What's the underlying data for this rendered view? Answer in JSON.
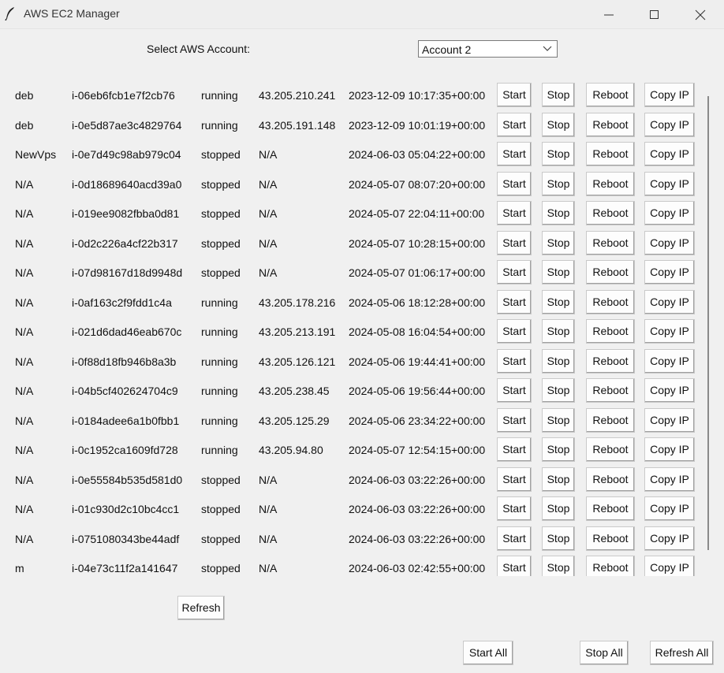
{
  "window": {
    "title": "AWS EC2 Manager",
    "app_icon": "feather-icon",
    "controls": [
      "minimize-icon",
      "maximize-icon",
      "close-icon"
    ]
  },
  "account": {
    "label": "Select AWS Account:",
    "selected": "Account 2"
  },
  "instances": [
    {
      "name": "deb",
      "id": "i-06eb6fcb1e7f2cb76",
      "state": "running",
      "ip": "43.205.210.241",
      "launched": "2023-12-09 10:17:35+00:00"
    },
    {
      "name": "deb",
      "id": "i-0e5d87ae3c4829764",
      "state": "running",
      "ip": "43.205.191.148",
      "launched": "2023-12-09 10:01:19+00:00"
    },
    {
      "name": "NewVps",
      "id": "i-0e7d49c98ab979c04",
      "state": "stopped",
      "ip": "N/A",
      "launched": "2024-06-03 05:04:22+00:00"
    },
    {
      "name": "N/A",
      "id": "i-0d18689640acd39a0",
      "state": "stopped",
      "ip": "N/A",
      "launched": "2024-05-07 08:07:20+00:00"
    },
    {
      "name": "N/A",
      "id": "i-019ee9082fbba0d81",
      "state": "stopped",
      "ip": "N/A",
      "launched": "2024-05-07 22:04:11+00:00"
    },
    {
      "name": "N/A",
      "id": "i-0d2c226a4cf22b317",
      "state": "stopped",
      "ip": "N/A",
      "launched": "2024-05-07 10:28:15+00:00"
    },
    {
      "name": "N/A",
      "id": "i-07d98167d18d9948d",
      "state": "stopped",
      "ip": "N/A",
      "launched": "2024-05-07 01:06:17+00:00"
    },
    {
      "name": "N/A",
      "id": "i-0af163c2f9fdd1c4a",
      "state": "running",
      "ip": "43.205.178.216",
      "launched": "2024-05-06 18:12:28+00:00"
    },
    {
      "name": "N/A",
      "id": "i-021d6dad46eab670c",
      "state": "running",
      "ip": "43.205.213.191",
      "launched": "2024-05-08 16:04:54+00:00"
    },
    {
      "name": "N/A",
      "id": "i-0f88d18fb946b8a3b",
      "state": "running",
      "ip": "43.205.126.121",
      "launched": "2024-05-06 19:44:41+00:00"
    },
    {
      "name": "N/A",
      "id": "i-04b5cf402624704c9",
      "state": "running",
      "ip": "43.205.238.45",
      "launched": "2024-05-06 19:56:44+00:00"
    },
    {
      "name": "N/A",
      "id": "i-0184adee6a1b0fbb1",
      "state": "running",
      "ip": "43.205.125.29",
      "launched": "2024-05-06 23:34:22+00:00"
    },
    {
      "name": "N/A",
      "id": "i-0c1952ca1609fd728",
      "state": "running",
      "ip": "43.205.94.80",
      "launched": "2024-05-07 12:54:15+00:00"
    },
    {
      "name": "N/A",
      "id": "i-0e55584b535d581d0",
      "state": "stopped",
      "ip": "N/A",
      "launched": "2024-06-03 03:22:26+00:00"
    },
    {
      "name": "N/A",
      "id": "i-01c930d2c10bc4cc1",
      "state": "stopped",
      "ip": "N/A",
      "launched": "2024-06-03 03:22:26+00:00"
    },
    {
      "name": "N/A",
      "id": "i-0751080343be44adf",
      "state": "stopped",
      "ip": "N/A",
      "launched": "2024-06-03 03:22:26+00:00"
    },
    {
      "name": "m",
      "id": "i-04e73c11f2a141647",
      "state": "stopped",
      "ip": "N/A",
      "launched": "2024-06-03 02:42:55+00:00"
    }
  ],
  "row_buttons": {
    "start": "Start",
    "stop": "Stop",
    "reboot": "Reboot",
    "copy_ip": "Copy IP"
  },
  "buttons": {
    "refresh": "Refresh",
    "start_all": "Start All",
    "stop_all": "Stop All",
    "refresh_all": "Refresh All"
  }
}
